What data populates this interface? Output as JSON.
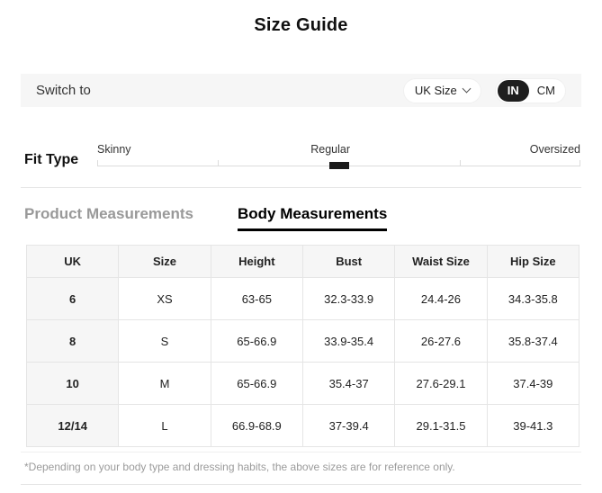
{
  "header": {
    "title": "Size Guide"
  },
  "switch_bar": {
    "label": "Switch to",
    "size_system_dropdown": {
      "selected": "UK Size",
      "icon": "chevron-down-icon"
    },
    "unit_toggle": {
      "options": [
        "IN",
        "CM"
      ],
      "selected": "IN"
    }
  },
  "fit_type": {
    "label": "Fit Type",
    "options": [
      "Skinny",
      "Regular",
      "Oversized"
    ],
    "selected": "Regular"
  },
  "tabs": [
    {
      "label": "Product Measurements",
      "active": false
    },
    {
      "label": "Body Measurements",
      "active": true
    }
  ],
  "table": {
    "headers": [
      "UK",
      "Size",
      "Height",
      "Bust",
      "Waist Size",
      "Hip Size"
    ],
    "rows": [
      [
        "6",
        "XS",
        "63-65",
        "32.3-33.9",
        "24.4-26",
        "34.3-35.8"
      ],
      [
        "8",
        "S",
        "65-66.9",
        "33.9-35.4",
        "26-27.6",
        "35.8-37.4"
      ],
      [
        "10",
        "M",
        "65-66.9",
        "35.4-37",
        "27.6-29.1",
        "37.4-39"
      ],
      [
        "12/14",
        "L",
        "66.9-68.9",
        "37-39.4",
        "29.1-31.5",
        "39-41.3"
      ]
    ]
  },
  "footnote": "*Depending on your body type and dressing habits, the above sizes are for reference only.",
  "colors": {
    "accent_black": "#1a1a1a",
    "panel_gray": "#f6f6f6",
    "border_gray": "#e5e5e5",
    "inactive_text": "#999999"
  }
}
